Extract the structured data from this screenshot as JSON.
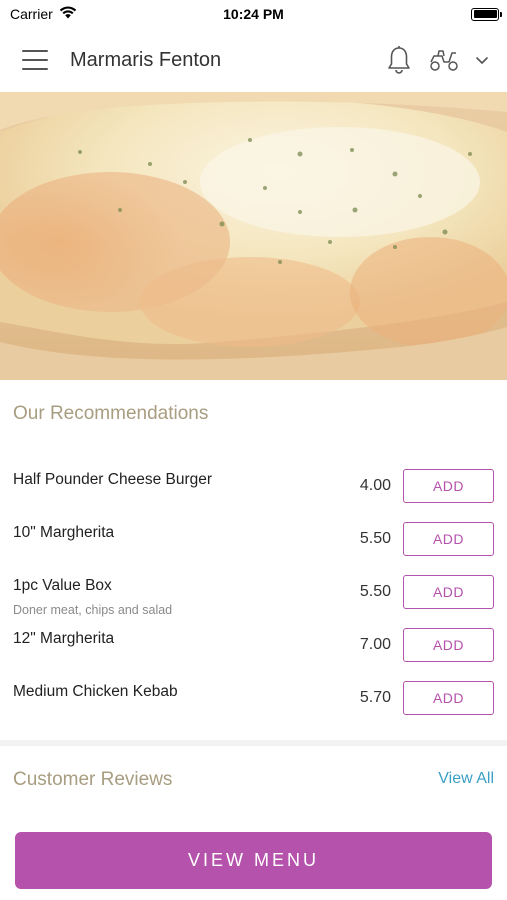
{
  "status_bar": {
    "carrier": "Carrier",
    "time": "10:24 PM",
    "icons": [
      "wifi-icon",
      "battery-icon"
    ]
  },
  "nav": {
    "title": "Marmaris Fenton",
    "icons": [
      "hamburger-menu-icon",
      "bell-icon",
      "delivery-scooter-icon",
      "chevron-down-icon"
    ]
  },
  "recommendations": {
    "title": "Our Recommendations",
    "items": [
      {
        "name": "Half Pounder Cheese Burger",
        "description": "",
        "price": "4.00",
        "button": "ADD"
      },
      {
        "name": "10\" Margherita",
        "description": "",
        "price": "5.50",
        "button": "ADD"
      },
      {
        "name": "1pc Value Box",
        "description": "Doner meat, chips and salad",
        "price": "5.50",
        "button": "ADD"
      },
      {
        "name": "12\" Margherita",
        "description": "",
        "price": "7.00",
        "button": "ADD"
      },
      {
        "name": "Medium Chicken Kebab",
        "description": "",
        "price": "5.70",
        "button": "ADD"
      }
    ]
  },
  "reviews": {
    "title": "Customer Reviews",
    "view_all": "View All"
  },
  "footer": {
    "view_menu": "VIEW MENU"
  },
  "colors": {
    "accent": "#b552ac",
    "section_title": "#a89d80",
    "link": "#3aa0c5"
  }
}
